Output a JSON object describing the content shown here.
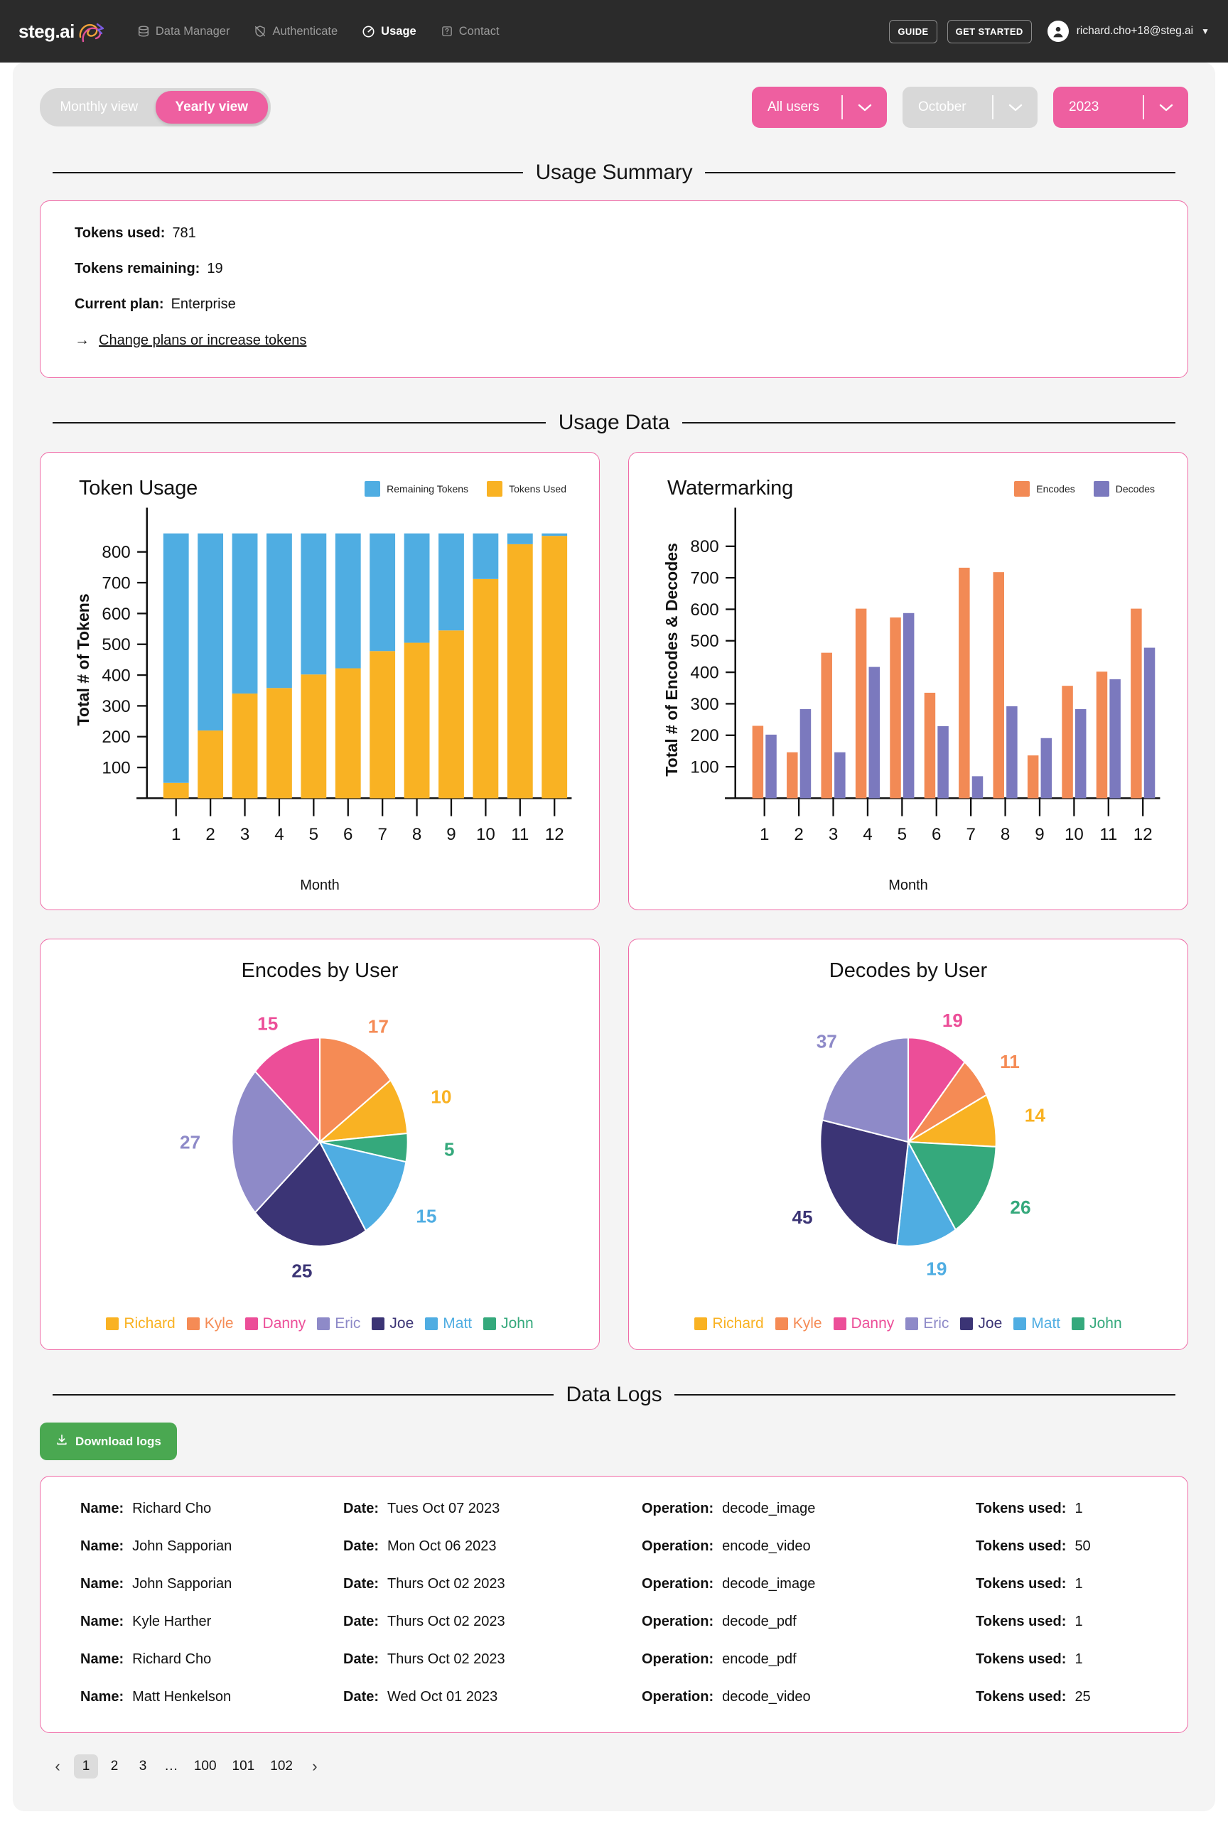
{
  "header": {
    "brand": "steg.ai",
    "nav": [
      {
        "label": "Data Manager",
        "icon": "database-icon",
        "active": false
      },
      {
        "label": "Authenticate",
        "icon": "shield-off-icon",
        "active": false
      },
      {
        "label": "Usage",
        "icon": "gauge-icon",
        "active": true
      },
      {
        "label": "Contact",
        "icon": "help-square-icon",
        "active": false
      }
    ],
    "guide_label": "GUIDE",
    "get_started_label": "GET STARTED",
    "user_email": "richard.cho+18@steg.ai"
  },
  "controls": {
    "view_toggle": {
      "monthly": "Monthly view",
      "yearly": "Yearly view",
      "selected": "Yearly view"
    },
    "user_filter": "All users",
    "month_filter": "October",
    "year_filter": "2023"
  },
  "usage_summary": {
    "section_title": "Usage Summary",
    "tokens_used_label": "Tokens used:",
    "tokens_used_value": "781",
    "tokens_remaining_label": "Tokens remaining:",
    "tokens_remaining_value": "19",
    "current_plan_label": "Current plan:",
    "current_plan_value": "Enterprise",
    "change_plans_link": "Change plans or increase tokens",
    "arrow": "→"
  },
  "usage_data": {
    "section_title": "Usage Data"
  },
  "data_logs": {
    "section_title": "Data Logs",
    "download_label": "Download logs",
    "columns": {
      "name": "Name:",
      "date": "Date:",
      "operation": "Operation:",
      "tokens": "Tokens used:"
    },
    "rows": [
      {
        "name": "Richard Cho",
        "date": "Tues Oct 07 2023",
        "operation": "decode_image",
        "tokens": "1"
      },
      {
        "name": "John Sapporian",
        "date": "Mon Oct 06 2023",
        "operation": "encode_video",
        "tokens": "50"
      },
      {
        "name": "John Sapporian",
        "date": "Thurs Oct 02 2023",
        "operation": "decode_image",
        "tokens": "1"
      },
      {
        "name": "Kyle Harther",
        "date": "Thurs Oct 02 2023",
        "operation": "decode_pdf",
        "tokens": "1"
      },
      {
        "name": "Richard Cho",
        "date": "Thurs Oct 02 2023",
        "operation": "encode_pdf",
        "tokens": "1"
      },
      {
        "name": "Matt Henkelson",
        "date": "Wed Oct 01 2023",
        "operation": "decode_video",
        "tokens": "25"
      }
    ]
  },
  "pagination": {
    "prev": "‹",
    "next": "›",
    "pages": [
      "1",
      "2",
      "3",
      "...",
      "100",
      "101",
      "102"
    ],
    "current": "1"
  },
  "colors": {
    "brand_pink": "#ee5fa0",
    "card_border": "#ef6aa6",
    "remaining_tokens": "#4FADE2",
    "tokens_used": "#F9B223",
    "encodes": "#F28A55",
    "decodes": "#7B79BE",
    "download_green": "#4aa851",
    "nav_bg": "#2b2b2b",
    "page_bg": "#f4f4f4"
  },
  "chart_data": [
    {
      "type": "bar",
      "id": "token-usage",
      "title": "Token Usage",
      "stacked": true,
      "xlabel": "Month",
      "ylabel": "Total # of Tokens",
      "categories": [
        "1",
        "2",
        "3",
        "4",
        "5",
        "6",
        "7",
        "8",
        "9",
        "10",
        "11",
        "12"
      ],
      "yticks": [
        100,
        200,
        300,
        400,
        500,
        600,
        700,
        800
      ],
      "ylim": [
        0,
        900
      ],
      "total_per_bar": 860,
      "legend_position": "top-right",
      "series": [
        {
          "name": "Tokens Used",
          "color": "#F9B223",
          "values": [
            50,
            220,
            340,
            358,
            402,
            422,
            478,
            505,
            545,
            712,
            825,
            852
          ]
        },
        {
          "name": "Remaining Tokens",
          "color": "#4FADE2",
          "values": [
            810,
            640,
            520,
            502,
            458,
            438,
            382,
            355,
            315,
            148,
            35,
            8
          ]
        }
      ]
    },
    {
      "type": "bar",
      "id": "watermarking",
      "title": "Watermarking",
      "stacked": false,
      "xlabel": "Month",
      "ylabel": "Total # of Encodes & Decodes",
      "categories": [
        "1",
        "2",
        "3",
        "4",
        "5",
        "6",
        "7",
        "8",
        "9",
        "10",
        "11",
        "12"
      ],
      "yticks": [
        100,
        200,
        300,
        400,
        500,
        600,
        700,
        800
      ],
      "ylim": [
        0,
        880
      ],
      "legend_position": "top-right",
      "series": [
        {
          "name": "Encodes",
          "color": "#F28A55",
          "values": [
            230,
            146,
            462,
            602,
            574,
            335,
            732,
            718,
            136,
            357,
            402,
            602
          ]
        },
        {
          "name": "Decodes",
          "color": "#7B79BE",
          "values": [
            202,
            283,
            146,
            417,
            588,
            229,
            70,
            292,
            191,
            283,
            378,
            478
          ]
        }
      ]
    },
    {
      "type": "pie",
      "id": "encodes-by-user",
      "title": "Encodes by User",
      "legend_position": "bottom",
      "labels": [
        "Richard",
        "Kyle",
        "Danny",
        "Eric",
        "Joe",
        "Matt",
        "John"
      ],
      "values": [
        10,
        17,
        15,
        27,
        25,
        15,
        5
      ],
      "colors": [
        "#F9B223",
        "#F58B55",
        "#EC4E98",
        "#8E8AC8",
        "#3B3475",
        "#4FADE2",
        "#35A97C"
      ],
      "slice_order": [
        "Kyle",
        "Richard",
        "John",
        "Matt",
        "Joe",
        "Eric",
        "Danny"
      ],
      "total": 114
    },
    {
      "type": "pie",
      "id": "decodes-by-user",
      "title": "Decodes by User",
      "legend_position": "bottom",
      "labels": [
        "Richard",
        "Kyle",
        "Danny",
        "Eric",
        "Joe",
        "Matt",
        "John"
      ],
      "values": [
        14,
        11,
        19,
        37,
        45,
        19,
        26
      ],
      "colors": [
        "#F9B223",
        "#F58B55",
        "#EC4E98",
        "#8E8AC8",
        "#3B3475",
        "#4FADE2",
        "#35A97C"
      ],
      "slice_order": [
        "Danny",
        "Kyle",
        "Richard",
        "John",
        "Matt",
        "Joe",
        "Eric"
      ],
      "total": 171
    }
  ]
}
